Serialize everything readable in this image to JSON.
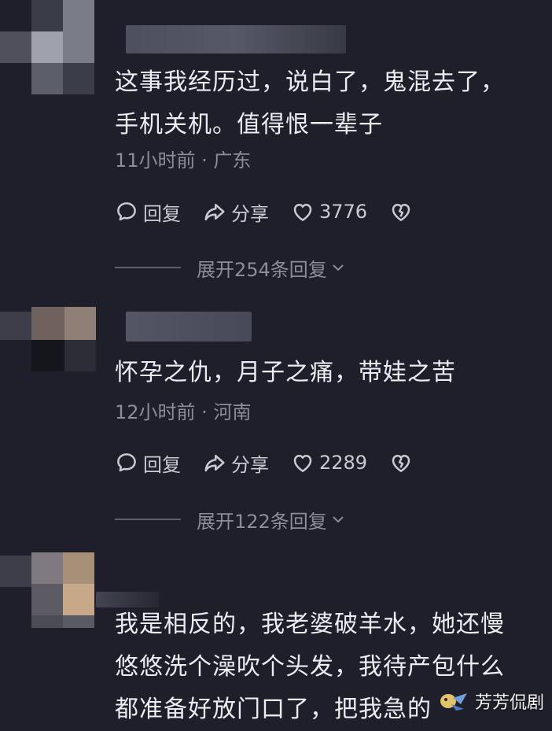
{
  "comments": [
    {
      "lines": [
        "这事我经历过，说白了，鬼混去了，",
        "手机关机。值得恨一辈子"
      ],
      "meta": "11小时前 · 广东",
      "reply_label": "回复",
      "share_label": "分享",
      "like_count": "3776",
      "expand_label": "展开254条回复"
    },
    {
      "lines": [
        "怀孕之仇，月子之痛，带娃之苦"
      ],
      "meta": "12小时前 · 河南",
      "reply_label": "回复",
      "share_label": "分享",
      "like_count": "2289",
      "expand_label": "展开122条回复"
    },
    {
      "lines": [
        "我是相反的，我老婆破羊水，她还慢",
        "悠悠洗个澡吹个头发，我待产包什么",
        "都准备好放门口了，把我急的"
      ]
    }
  ],
  "watermark": {
    "text": "芳芳侃剧"
  },
  "icons": {
    "reply": "speech-bubble-icon",
    "share": "share-arrow-icon",
    "like": "heart-icon",
    "dislike": "broken-heart-icon",
    "expand": "chevron-down-icon"
  },
  "colors": {
    "background": "#1e1f2a",
    "text_primary": "#ecedf2",
    "text_secondary": "#8b8d99",
    "action_text": "#c9cad2"
  }
}
